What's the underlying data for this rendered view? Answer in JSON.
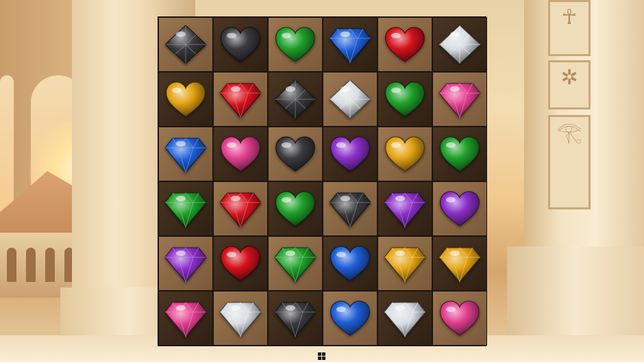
{
  "game": {
    "board": {
      "rows": 6,
      "cols": 6,
      "cells": [
        [
          "black-diamond",
          "black-heart",
          "green-heart",
          "blue-round",
          "red-heart",
          "white-diamond"
        ],
        [
          "yellow-heart",
          "red-round",
          "black-diamond",
          "white-diamond",
          "green-heart",
          "pink-round"
        ],
        [
          "blue-round",
          "pink-heart",
          "black-heart",
          "purple-heart",
          "yellow-heart",
          "green-heart"
        ],
        [
          "green-round",
          "red-round",
          "green-heart",
          "black-round",
          "purple-round",
          "purple-heart"
        ],
        [
          "purple-round",
          "red-heart",
          "green-round",
          "blue-heart",
          "yellow-round",
          "yellow-round"
        ],
        [
          "pink-round",
          "white-round",
          "black-round",
          "blue-heart",
          "white-round",
          "pink-heart"
        ]
      ]
    },
    "colors": {
      "black": "#3a3a3e",
      "white": "#d8dce2",
      "green": "#1fa02a",
      "blue": "#1f5ed8",
      "red": "#d5121c",
      "yellow": "#e4a314",
      "pink": "#e33f8f",
      "purple": "#8b2fc9",
      "board_border": "#1c140d"
    },
    "taskbar_icon": "windows-logo-icon"
  }
}
